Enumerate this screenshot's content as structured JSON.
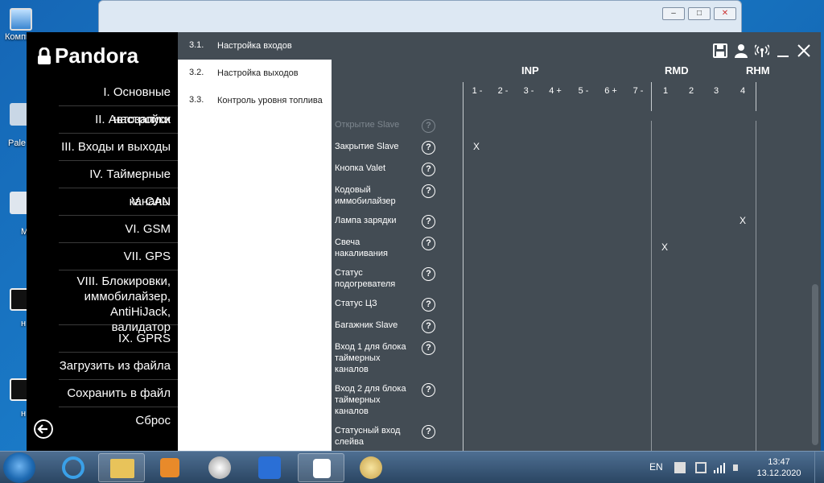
{
  "desktop": {
    "icons": [
      {
        "label": "Компь"
      },
      {
        "label": "Pale"
      },
      {
        "label": "M"
      },
      {
        "label": "н"
      },
      {
        "label": "н"
      }
    ],
    "right_fragment": "a"
  },
  "app": {
    "logo_text": "Pandora",
    "menu": [
      {
        "label": "I. Основные настройки"
      },
      {
        "label": "II. Автозапуск"
      },
      {
        "label": "III. Входы и выходы"
      },
      {
        "label": "IV. Таймерные каналы"
      },
      {
        "label": "V. CAN"
      },
      {
        "label": "VI. GSM"
      },
      {
        "label": "VII. GPS"
      },
      {
        "label": "VIII. Блокировки, иммобилайзер, AntiHiJack, валидатор"
      },
      {
        "label": "IX. GPRS"
      },
      {
        "label": "Загрузить из файла"
      },
      {
        "label": "Сохранить в файл"
      },
      {
        "label": "Сброс"
      }
    ],
    "submenu": [
      {
        "num": "3.1.",
        "label": "Настройка входов",
        "active": true
      },
      {
        "num": "3.2.",
        "label": "Настройка выходов"
      },
      {
        "num": "3.3.",
        "label": "Контроль уровня топлива"
      }
    ],
    "groups": {
      "inp": "INP",
      "rmd": "RMD",
      "rhm": "RHM"
    },
    "inp_columns": [
      "1 -",
      "2 -",
      "3 -",
      "4 +",
      "5 -",
      "6 +",
      "7 -"
    ],
    "rmd_columns": [
      "1",
      "2",
      "3",
      "4"
    ],
    "help_symbol": "?",
    "mark_symbol": "X",
    "rows": [
      {
        "label": "Открытие Slave",
        "faded": true
      },
      {
        "label": "Закрытие Slave",
        "mark": "X"
      },
      {
        "label": "Кнопка Valet"
      },
      {
        "label": "Кодовый иммобилайзер"
      },
      {
        "label": "Лампа зарядки",
        "mark": "X"
      },
      {
        "label": "Свеча накаливания",
        "mark": "X"
      },
      {
        "label": "Статус подогревателя"
      },
      {
        "label": "Статус ЦЗ"
      },
      {
        "label": "Багажник Slave"
      },
      {
        "label": "Вход 1 для блока таймерных каналов"
      },
      {
        "label": "Вход 2 для блока таймерных каналов"
      },
      {
        "label": "Статусный вход слейва"
      }
    ]
  },
  "taskbar": {
    "lang": "EN",
    "time": "13:47",
    "date": "13.12.2020"
  }
}
